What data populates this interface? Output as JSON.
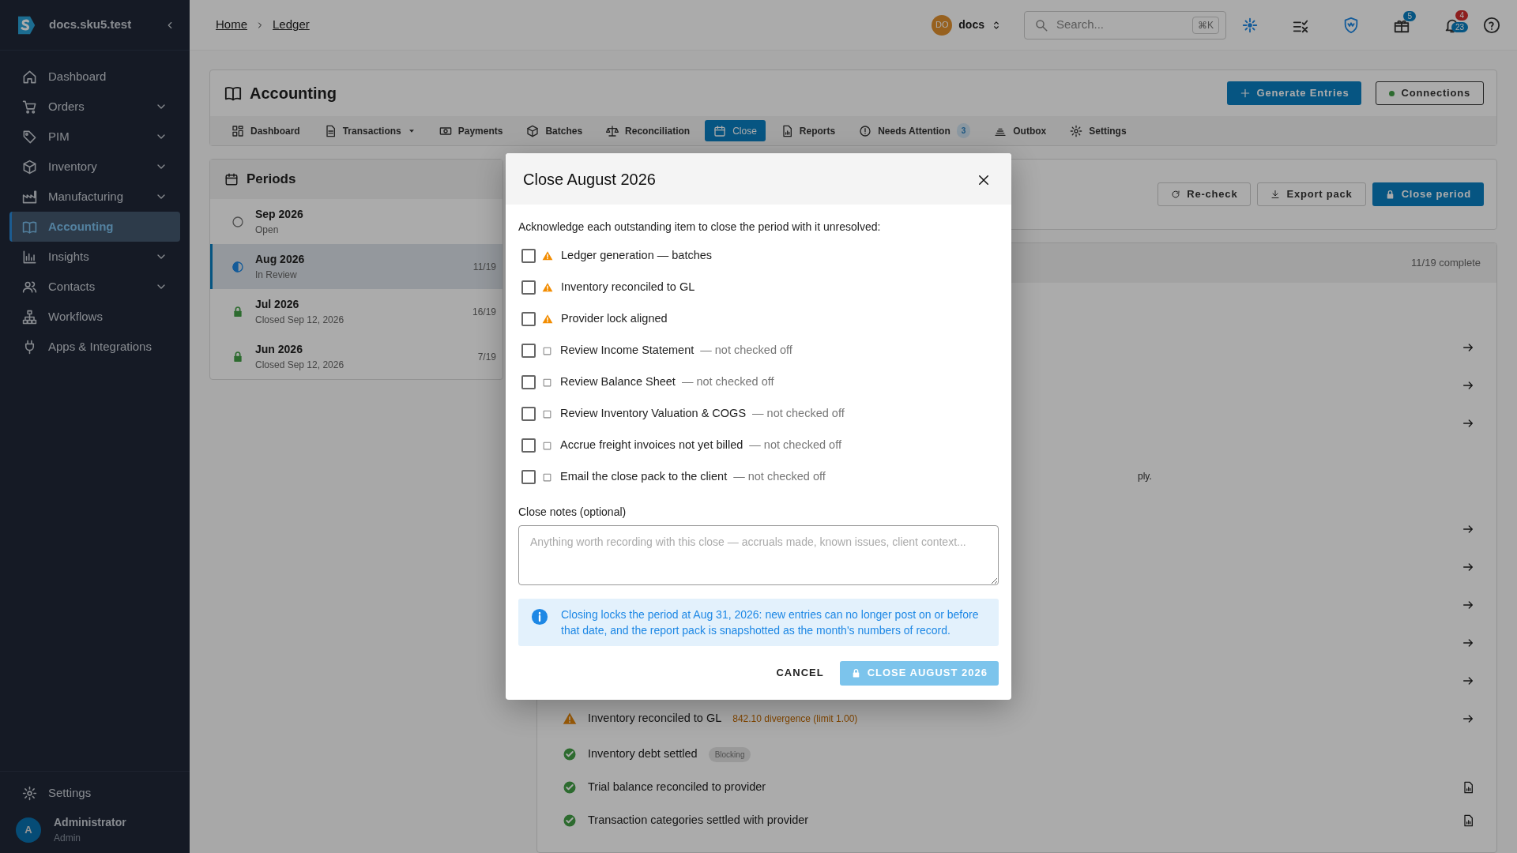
{
  "sidebar": {
    "brand": "docs.sku5.test",
    "items": [
      {
        "label": "Dashboard",
        "expandable": false,
        "selected": false
      },
      {
        "label": "Orders",
        "expandable": true,
        "selected": false
      },
      {
        "label": "PIM",
        "expandable": true,
        "selected": false
      },
      {
        "label": "Inventory",
        "expandable": true,
        "selected": false
      },
      {
        "label": "Manufacturing",
        "expandable": true,
        "selected": false
      },
      {
        "label": "Accounting",
        "expandable": false,
        "selected": true
      },
      {
        "label": "Insights",
        "expandable": true,
        "selected": false
      },
      {
        "label": "Contacts",
        "expandable": true,
        "selected": false
      },
      {
        "label": "Workflows",
        "expandable": false,
        "selected": false
      },
      {
        "label": "Apps & Integrations",
        "expandable": false,
        "selected": false
      }
    ],
    "footer": {
      "label": "Settings"
    },
    "user": {
      "initial": "A",
      "name": "Administrator",
      "role": "Admin"
    }
  },
  "topbar": {
    "breadcrumbs": [
      "Home",
      "Ledger"
    ],
    "org": {
      "initials": "DO",
      "name": "docs"
    },
    "search": {
      "placeholder": "Search...",
      "shortcut": "⌘K"
    },
    "gift_badge": "5",
    "notification_badges": [
      "4",
      "23"
    ]
  },
  "accounting": {
    "title": "Accounting",
    "actions": [
      {
        "label": "Generate Entries",
        "kind": "primary"
      },
      {
        "label": "Connections",
        "kind": "status",
        "connected": true
      }
    ],
    "tabs": [
      {
        "label": "Dashboard",
        "selected": false
      },
      {
        "label": "Transactions",
        "selected": false,
        "dropdown": true
      },
      {
        "label": "Payments",
        "selected": false
      },
      {
        "label": "Batches",
        "selected": false
      },
      {
        "label": "Reconciliation",
        "selected": false
      },
      {
        "label": "Close",
        "selected": true
      },
      {
        "label": "Reports",
        "selected": false
      },
      {
        "label": "Needs Attention",
        "selected": false,
        "badge": "3"
      },
      {
        "label": "Outbox",
        "selected": false
      },
      {
        "label": "Settings",
        "selected": false
      }
    ]
  },
  "periods": {
    "title": "Periods",
    "items": [
      {
        "name": "Sep 2026",
        "status": "Open",
        "kind": "open",
        "selected": false
      },
      {
        "name": "Aug 2026",
        "status": "In Review",
        "count": "11/19",
        "kind": "review",
        "selected": true
      },
      {
        "name": "Jul 2026",
        "status": "Closed Sep 12, 2026",
        "count": "16/19",
        "kind": "closed",
        "selected": false
      },
      {
        "name": "Jun 2026",
        "status": "Closed Sep 12, 2026",
        "count": "7/19",
        "kind": "closed",
        "selected": false
      }
    ]
  },
  "period_actions": [
    {
      "label": "Re-check",
      "kind": "refresh"
    },
    {
      "label": "Export pack",
      "kind": "download"
    },
    {
      "label": "Close period",
      "kind": "lock"
    }
  ],
  "checklist": {
    "summary": "11/19 complete",
    "rows": [
      {
        "kind": "hidden",
        "link": true
      },
      {
        "kind": "hidden",
        "link": true
      },
      {
        "kind": "hidden",
        "link": true
      },
      {
        "kind": "note",
        "text": "ply."
      },
      {
        "kind": "hidden",
        "link": true
      },
      {
        "kind": "hidden",
        "link": true
      },
      {
        "kind": "hidden",
        "link": true
      },
      {
        "kind": "hidden",
        "link": true
      },
      {
        "kind": "hidden",
        "link": true
      },
      {
        "kind": "warning",
        "label": "Inventory reconciled to GL",
        "detail": "842.10 divergence (limit 1.00)",
        "link": true
      },
      {
        "kind": "done",
        "label": "Inventory debt settled",
        "badge": "Blocking"
      },
      {
        "kind": "done",
        "label": "Trial balance reconciled to provider",
        "report": true
      },
      {
        "kind": "done",
        "label": "Transaction categories settled with provider",
        "report": true
      }
    ]
  },
  "dialog": {
    "title": "Close August 2026",
    "intro": "Acknowledge each outstanding item to close the period with it unresolved:",
    "items": [
      {
        "kind": "warning",
        "label": "Ledger generation — batches",
        "checked": false
      },
      {
        "kind": "warning",
        "label": "Inventory reconciled to GL",
        "checked": false
      },
      {
        "kind": "warning",
        "label": "Provider lock aligned",
        "checked": false
      },
      {
        "kind": "task",
        "label": "Review Income Statement",
        "note": "— not checked off",
        "checked": false
      },
      {
        "kind": "task",
        "label": "Review Balance Sheet",
        "note": "— not checked off",
        "checked": false
      },
      {
        "kind": "task",
        "label": "Review Inventory Valuation & COGS",
        "note": "— not checked off",
        "checked": false
      },
      {
        "kind": "task",
        "label": "Accrue freight invoices not yet billed",
        "note": "— not checked off",
        "checked": false
      },
      {
        "kind": "task",
        "label": "Email the close pack to the client",
        "note": "— not checked off",
        "checked": false
      }
    ],
    "notes_label": "Close notes (optional)",
    "notes_placeholder": "Anything worth recording with this close — accruals made, known issues, client context...",
    "info": "Closing locks the period at Aug 31, 2026: new entries can no longer post on or before that date, and the report pack is snapshotted as the month's numbers of record.",
    "cancel": "CANCEL",
    "confirm": {
      "label": "CLOSE AUGUST 2026",
      "disabled": true
    }
  }
}
